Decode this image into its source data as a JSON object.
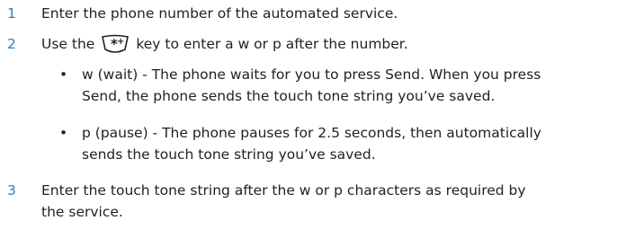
{
  "colors": {
    "step_number": "#2f7fbf",
    "text": "#231f20"
  },
  "steps": [
    {
      "num": "1",
      "text": "Enter the phone number of the automated service."
    },
    {
      "num": "2",
      "before_icon": "Use the",
      "icon": "star-key-icon",
      "after_icon": "key to enter a w or p after the number."
    },
    {
      "num": "3",
      "line1": "Enter the touch tone string after the w or p characters as required by",
      "line2": "the service."
    }
  ],
  "bullets": [
    {
      "line1": "w (wait) - The phone waits for you to press Send. When you press",
      "line2": "Send, the phone sends the touch tone string you’ve saved."
    },
    {
      "line1": "p (pause) - The phone pauses for 2.5 seconds, then automatically",
      "line2": "sends the touch tone string you’ve saved."
    }
  ],
  "bullet_glyph": "•"
}
